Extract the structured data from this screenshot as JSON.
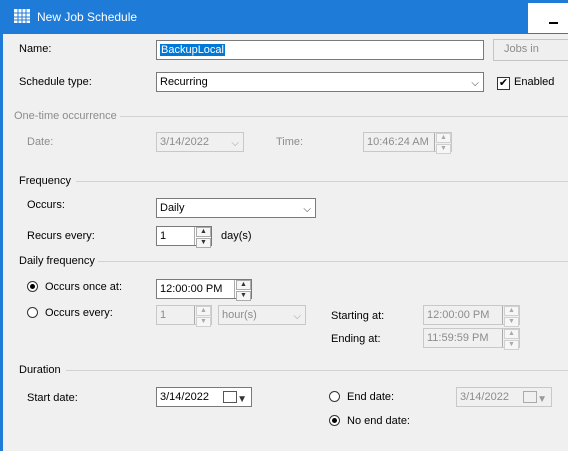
{
  "window": {
    "title": "New Job Schedule"
  },
  "name": {
    "label": "Name:",
    "value": "BackupLocal",
    "jobs_button": "Jobs in"
  },
  "schedule_type": {
    "label": "Schedule type:",
    "value": "Recurring",
    "enabled_label": "Enabled",
    "enabled": true
  },
  "one_time": {
    "heading": "One-time occurrence",
    "date_label": "Date:",
    "date_value": "3/14/2022",
    "time_label": "Time:",
    "time_value": "10:46:24 AM"
  },
  "frequency": {
    "heading": "Frequency",
    "occurs_label": "Occurs:",
    "occurs_value": "Daily",
    "recurs_label": "Recurs every:",
    "recurs_value": "1",
    "recurs_unit": "day(s)"
  },
  "daily": {
    "heading": "Daily frequency",
    "once_label": "Occurs once at:",
    "once_value": "12:00:00 PM",
    "every_label": "Occurs every:",
    "every_value": "1",
    "every_unit": "hour(s)",
    "starting_label": "Starting at:",
    "starting_value": "12:00:00 PM",
    "ending_label": "Ending at:",
    "ending_value": "11:59:59 PM"
  },
  "duration": {
    "heading": "Duration",
    "start_label": "Start date:",
    "start_value": "3/14/2022",
    "end_label": "End date:",
    "end_value": "3/14/2022",
    "no_end_label": "No end date:"
  },
  "colors": {
    "titlebar": "#1e7bd8",
    "selection": "#0078d7"
  }
}
